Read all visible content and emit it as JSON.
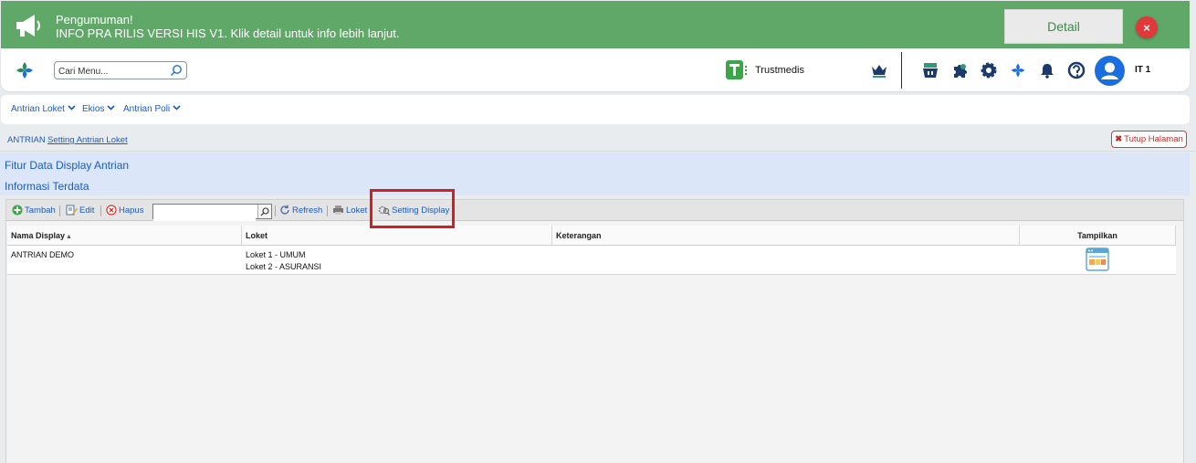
{
  "announcement": {
    "title": "Pengumuman!",
    "message": "INFO PRA RILIS VERSI HIS V1. Klik detail untuk info lebih lanjut.",
    "detail_label": "Detail",
    "close_label": "×"
  },
  "header": {
    "search_placeholder": "Cari Menu...",
    "brand": "Trustmedis",
    "user": "IT 1"
  },
  "menu": [
    "Antrian Loket",
    "Ekios",
    "Antrian Poli"
  ],
  "breadcrumb": [
    "ANTRIAN",
    "Setting Antrian Loket"
  ],
  "close_page_label": "Tutup Halaman",
  "panel_titles": [
    "Fitur Data Display Antrian",
    "Informasi Terdata"
  ],
  "toolbar": {
    "add": "Tambah",
    "edit": "Edit",
    "delete": "Hapus",
    "refresh": "Refresh",
    "loket": "Loket",
    "setting_display": "Setting Display"
  },
  "table": {
    "columns": [
      "Nama Display",
      "Loket",
      "Keterangan",
      "Tampilkan"
    ],
    "sort_indicator": "▲",
    "rows": [
      {
        "nama_display": "ANTRIAN DEMO",
        "loket": [
          "Loket 1 - UMUM",
          "Loket 2 - ASURANSI"
        ],
        "keterangan": ""
      }
    ]
  },
  "colors": {
    "banner": "#5fa868",
    "link": "#1a5bc0",
    "accent_blue": "#1a6fe0",
    "danger": "#d9363e",
    "highlight": "#d02020"
  }
}
